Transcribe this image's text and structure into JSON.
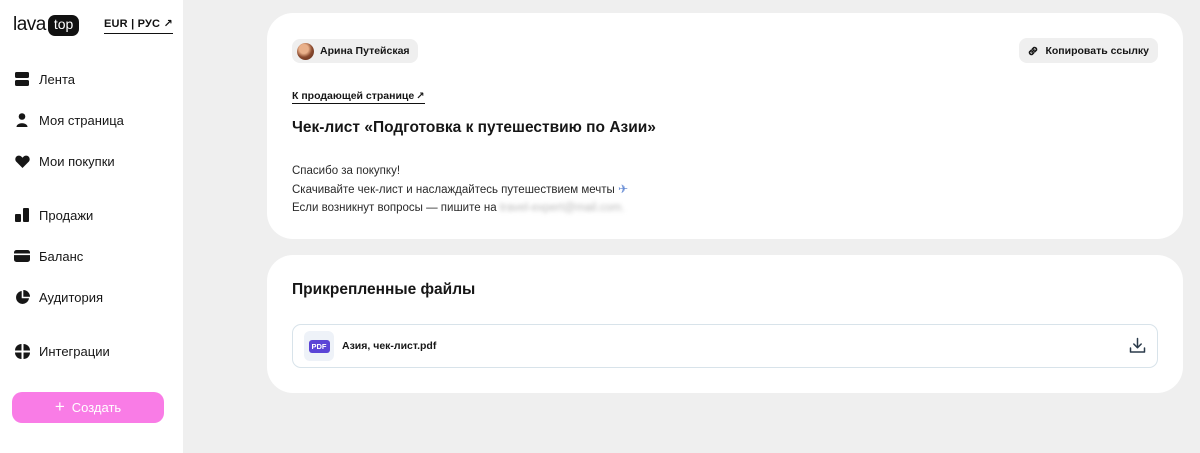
{
  "brand": {
    "logo_left": "lava",
    "logo_right": "top"
  },
  "header": {
    "lang_switch": "EUR | РУС ↗"
  },
  "sidebar": {
    "items": [
      {
        "label": "Лента",
        "icon": "feed-icon"
      },
      {
        "label": "Моя страница",
        "icon": "user-icon"
      },
      {
        "label": "Мои покупки",
        "icon": "heart-icon"
      },
      {
        "label": "Продажи",
        "icon": "sales-chart-icon"
      },
      {
        "label": "Баланс",
        "icon": "wallet-card-icon"
      },
      {
        "label": "Аудитория",
        "icon": "pie-chart-icon"
      },
      {
        "label": "Интеграции",
        "icon": "integrations-icon"
      }
    ],
    "create_label": "Создать"
  },
  "product": {
    "author_name": "Арина Путейская",
    "copy_link_label": "Копировать ссылку",
    "seller_link_label": "К продающей странице",
    "title": "Чек-лист «Подготовка к путешествию по Азии»",
    "message_line1": "Спасибо за покупку!",
    "message_line2": "Скачивайте чек-лист и наслаждайтесь путешествием мечты",
    "message_line3": "Если возникнут вопросы — пишите на",
    "message_email": "travel-expert@mail.com."
  },
  "files": {
    "title": "Прикрепленные файлы",
    "items": [
      {
        "badge": "PDF",
        "name": "Азия, чек-лист.pdf"
      }
    ]
  },
  "colors": {
    "accent_pink": "#f97ce6",
    "pdf_badge": "#5b45d6",
    "page_bg": "#efefef"
  }
}
